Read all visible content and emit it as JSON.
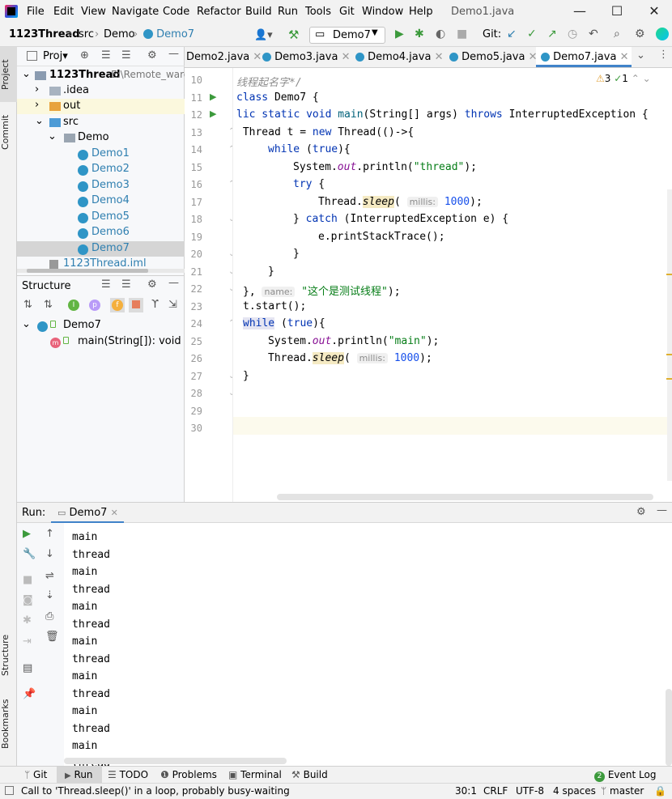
{
  "titlebar": {
    "menus": [
      "File",
      "Edit",
      "View",
      "Navigate",
      "Code",
      "Refactor",
      "Build",
      "Run",
      "Tools",
      "Git",
      "Window",
      "Help"
    ],
    "title": "Demo1.java",
    "win_min": "—",
    "win_max": "☐",
    "win_close": "✕"
  },
  "navbar": {
    "crumbs": [
      "1123Thread",
      "src",
      "Demo",
      "Demo7"
    ],
    "run_config": "Demo7",
    "git_label": "Git:"
  },
  "left_stripe": {
    "project": "Project",
    "commit": "Commit",
    "structure": "Structure",
    "bookmarks": "Bookmarks"
  },
  "project": {
    "header": "Proj",
    "root": "1123Thread",
    "root_path": "E:\\Remote_wareh",
    "items": [
      {
        "label": ".idea"
      },
      {
        "label": "out"
      },
      {
        "label": "src"
      },
      {
        "label": "Demo"
      },
      {
        "label": "Demo1"
      },
      {
        "label": "Demo2"
      },
      {
        "label": "Demo3"
      },
      {
        "label": "Demo4"
      },
      {
        "label": "Demo5"
      },
      {
        "label": "Demo6"
      },
      {
        "label": "Demo7"
      },
      {
        "label": "1123Thread.iml"
      }
    ]
  },
  "structure": {
    "header": "Structure",
    "class_name": "Demo7",
    "method": "main(String[]): void"
  },
  "editor": {
    "tabs": [
      "Demo2.java",
      "Demo3.java",
      "Demo4.java",
      "Demo5.java",
      "Demo7.java"
    ],
    "warnings": "3",
    "weak_warnings": "1",
    "line_numbers": [
      "10",
      "11",
      "12",
      "13",
      "14",
      "15",
      "16",
      "17",
      "18",
      "19",
      "20",
      "21",
      "22",
      "23",
      "24",
      "25",
      "26",
      "27",
      "28",
      "29",
      "30"
    ],
    "comment": "线程起名字*/",
    "class_kw": "class",
    "class_decl": " Demo7 {",
    "main_sig_prefix": "lic static void ",
    "main_sig_name": "main",
    "main_sig_rest": "(String[] args) ",
    "main_throws": "throws",
    "main_exc": " InterruptedException {",
    "thread_decl": " Thread t = ",
    "new_kw": "new",
    "thread_ctor": " Thread(()->{",
    "while_kw": "while",
    "true_paren": " (",
    "true_kw": "true",
    "while_end": "){",
    "sysout_a": "System.",
    "sysout_out": "out",
    "sysout_b": ".println(",
    "str_thread": "\"thread\"",
    "line_end": ");",
    "try_kw": "try",
    "try_brace": " {",
    "sleep_prefix": "Thread.",
    "sleep_name": "sleep",
    "paren_open": "(",
    "hint_millis": "millis:",
    "num_1000": "1000",
    "catch_close": "} ",
    "catch_kw": "catch",
    "catch_rest": " (InterruptedException e) {",
    "stack_trace": "e.printStackTrace();",
    "close_brace": "}",
    "close_call": "},",
    "hint_name": "name:",
    "str_name": "\"这个是测试线程\"",
    "start_call": "t.start();",
    "str_main": "\"main\""
  },
  "run": {
    "label": "Run:",
    "tab": "Demo7",
    "output": [
      "thread",
      "main",
      "thread",
      "main",
      "thread",
      "main",
      "thread",
      "main",
      "thread",
      "main",
      "thread",
      "main",
      "thread",
      "main",
      "thread"
    ]
  },
  "bottom_tabs": [
    "Git",
    "Run",
    "TODO",
    "Problems",
    "Terminal",
    "Build"
  ],
  "event_log": "Event Log",
  "status": {
    "message": "Call to 'Thread.sleep()' in a loop, probably busy-waiting",
    "position": "30:1",
    "line_sep": "CRLF",
    "encoding": "UTF-8",
    "indent": "4 spaces",
    "branch": "master"
  }
}
